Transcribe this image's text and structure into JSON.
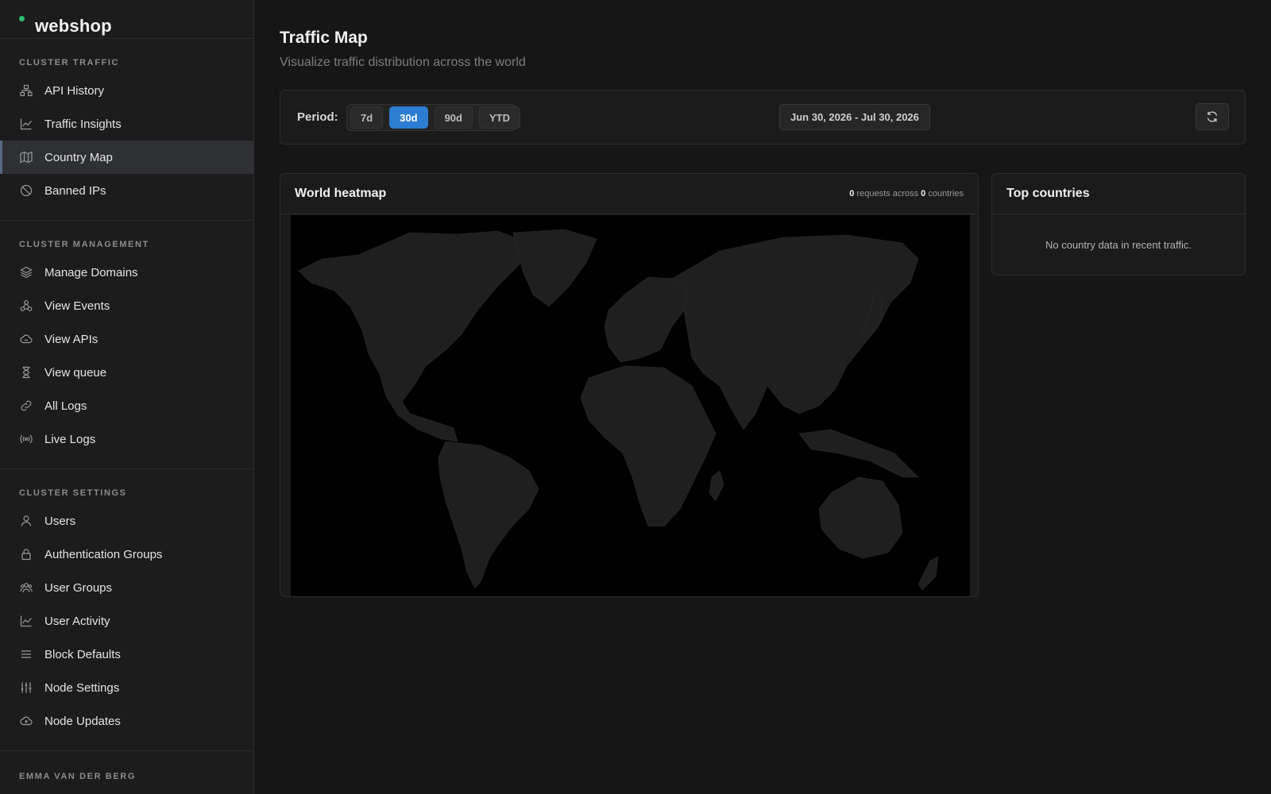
{
  "brand": {
    "name": "webshop",
    "status_color": "#2fbf71"
  },
  "sidebar": {
    "sections": [
      {
        "title": "CLUSTER TRAFFIC",
        "items": [
          {
            "label": "API History",
            "icon": "network-icon"
          },
          {
            "label": "Traffic Insights",
            "icon": "line-chart-icon"
          },
          {
            "label": "Country Map",
            "icon": "map-icon",
            "active": true
          },
          {
            "label": "Banned IPs",
            "icon": "ban-icon"
          }
        ]
      },
      {
        "title": "CLUSTER MANAGEMENT",
        "items": [
          {
            "label": "Manage Domains",
            "icon": "layers-icon"
          },
          {
            "label": "View Events",
            "icon": "webhook-icon"
          },
          {
            "label": "View APIs",
            "icon": "cloud-icon"
          },
          {
            "label": "View queue",
            "icon": "hourglass-icon"
          },
          {
            "label": "All Logs",
            "icon": "link-icon"
          },
          {
            "label": "Live Logs",
            "icon": "broadcast-icon"
          }
        ]
      },
      {
        "title": "CLUSTER SETTINGS",
        "items": [
          {
            "label": "Users",
            "icon": "user-icon"
          },
          {
            "label": "Authentication Groups",
            "icon": "lock-icon"
          },
          {
            "label": "User Groups",
            "icon": "users-icon"
          },
          {
            "label": "User Activity",
            "icon": "line-chart-icon"
          },
          {
            "label": "Block Defaults",
            "icon": "list-icon"
          },
          {
            "label": "Node Settings",
            "icon": "sliders-icon"
          },
          {
            "label": "Node Updates",
            "icon": "cloud-upload-icon"
          }
        ]
      }
    ],
    "user_section_title": "EMMA VAN DER BERG"
  },
  "header": {
    "title": "Traffic Map",
    "subtitle": "Visualize traffic distribution across the world"
  },
  "period": {
    "label": "Period:",
    "options": [
      "7d",
      "30d",
      "90d",
      "YTD"
    ],
    "selected": "30d",
    "date_range": "Jun 30, 2026 - Jul 30, 2026",
    "accent_color": "#2d7dd2"
  },
  "heatmap": {
    "title": "World heatmap",
    "requests": "0",
    "requests_label": "requests across",
    "countries": "0",
    "countries_label": "countries"
  },
  "top_countries": {
    "title": "Top countries",
    "empty_message": "No country data in recent traffic."
  }
}
